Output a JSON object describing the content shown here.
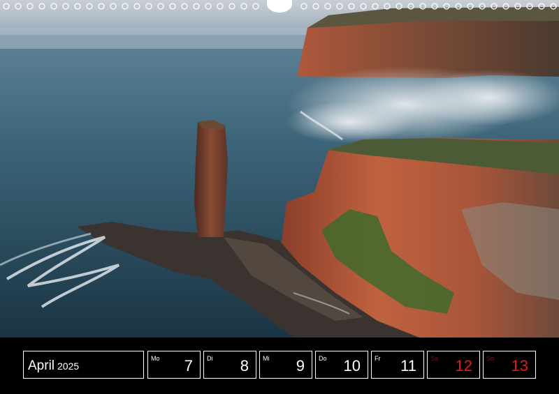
{
  "calendar": {
    "month": "April",
    "year": "2025",
    "days": [
      {
        "name": "Mo",
        "number": "7",
        "weekend": false
      },
      {
        "name": "Di",
        "number": "8",
        "weekend": false
      },
      {
        "name": "Mi",
        "number": "9",
        "weekend": false
      },
      {
        "name": "Do",
        "number": "10",
        "weekend": false
      },
      {
        "name": "Fr",
        "number": "11",
        "weekend": false
      },
      {
        "name": "Sa",
        "number": "12",
        "weekend": true
      },
      {
        "name": "So",
        "number": "13",
        "weekend": true
      }
    ]
  },
  "colors": {
    "background": "#000000",
    "text": "#ffffff",
    "weekend": "#e31b1b"
  }
}
